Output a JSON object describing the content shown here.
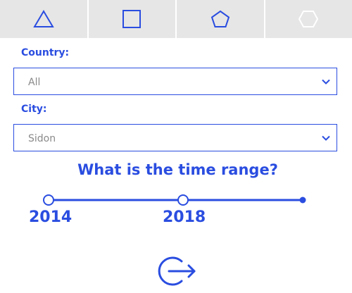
{
  "tabs": [
    {
      "icon": "triangle-icon",
      "active": true
    },
    {
      "icon": "square-icon",
      "active": true
    },
    {
      "icon": "pentagon-icon",
      "active": true
    },
    {
      "icon": "hexagon-icon",
      "active": false
    }
  ],
  "country": {
    "label": "Country:",
    "value": "All"
  },
  "city": {
    "label": "City:",
    "value": "Sidon"
  },
  "time_range": {
    "question": "What is the time range?",
    "start_label": "2014",
    "end_label": "2018"
  },
  "submit": {
    "icon": "arrow-right-circle-icon"
  },
  "colors": {
    "accent": "#2a4de0",
    "tab_bg": "#e6e6e6",
    "muted": "#8a8a8a"
  }
}
